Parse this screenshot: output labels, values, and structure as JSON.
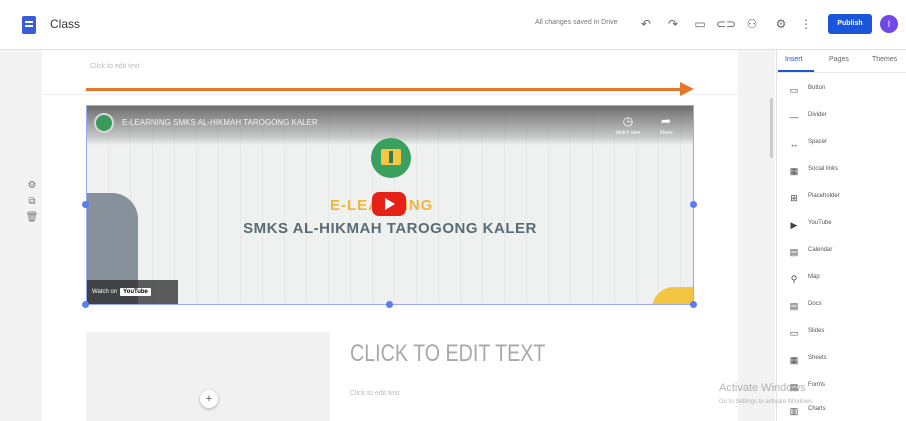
{
  "header": {
    "title": "Class",
    "status": "All changes saved in Drive",
    "publish_label": "Publish",
    "avatar_letter": "I"
  },
  "canvas": {
    "hint_top": "Click to edit text",
    "heading_text": "CLICK TO EDIT TEXT",
    "hint_lower": "Click to edit text"
  },
  "video": {
    "title": "E-LEARNING SMKS AL-HIKMAH TAROGONG KALER",
    "watch_later": "Watch later",
    "share": "Share",
    "elearning_text": "E-LEARNING",
    "school_name": "SMKS AL-HIKMAH TAROGONG KALER",
    "watch_on": "Watch on",
    "youtube": "YouTube"
  },
  "panel": {
    "tabs": [
      "Insert",
      "Pages",
      "Themes"
    ],
    "items": [
      {
        "label": "Button",
        "icon": "button-icon"
      },
      {
        "label": "Divider",
        "icon": "divider-icon"
      },
      {
        "label": "Spacer",
        "icon": "spacer-icon"
      },
      {
        "label": "Social links",
        "icon": "social-links-icon"
      },
      {
        "label": "Placeholder",
        "icon": "placeholder-icon"
      },
      {
        "label": "YouTube",
        "icon": "youtube-icon"
      },
      {
        "label": "Calendar",
        "icon": "calendar-icon"
      },
      {
        "label": "Map",
        "icon": "map-icon"
      },
      {
        "label": "Docs",
        "icon": "docs-icon"
      },
      {
        "label": "Slides",
        "icon": "slides-icon"
      },
      {
        "label": "Sheets",
        "icon": "sheets-icon"
      },
      {
        "label": "Forms",
        "icon": "forms-icon"
      },
      {
        "label": "Charts",
        "icon": "charts-icon"
      }
    ]
  },
  "watermark": {
    "line1": "Activate Windows",
    "line2": "Go to Settings to activate Windows."
  },
  "colors": {
    "accent": "#1a56db",
    "annotation_arrow": "#e5762a",
    "avatar": "#7048e8"
  }
}
